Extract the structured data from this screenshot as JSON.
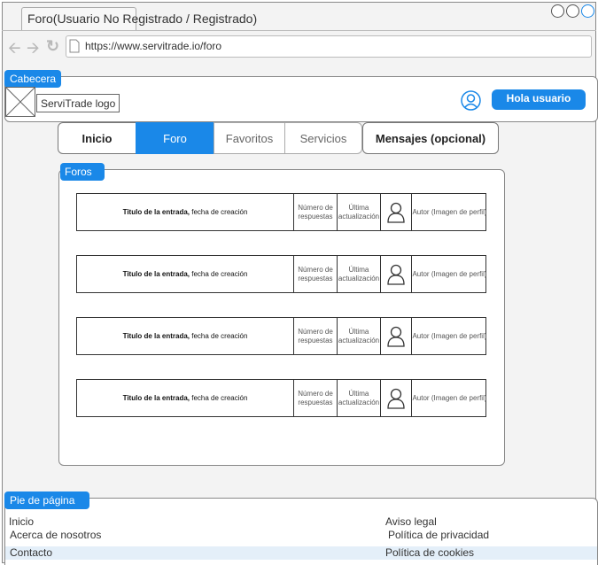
{
  "browser": {
    "tab_title": "Foro(Usuario No Registrado / Registrado)",
    "url": "https://www.servitrade.io/foro"
  },
  "header": {
    "section_label": "Cabecera",
    "logo_text": "ServiTrade logo",
    "user_button": "Hola usuario"
  },
  "nav": {
    "tabs": [
      "Inicio",
      "Foro",
      "Favoritos",
      "Servicios",
      "Mensajes (opcional)"
    ],
    "active": "Foro"
  },
  "forums": {
    "section_label": "Foros",
    "rows": [
      {
        "title": "Titulo de la entrada,",
        "date": " fecha de creación",
        "replies": "Número de respuestas",
        "updated": "Última actualización",
        "author": "Autor (Imagen de perfil)"
      },
      {
        "title": "Titulo de la entrada,",
        "date": " fecha de creación",
        "replies": "Número de respuestas",
        "updated": "Última actualización",
        "author": "Autor (Imagen de perfil)"
      },
      {
        "title": "Titulo de la entrada,",
        "date": " fecha de creación",
        "replies": "Número de respuestas",
        "updated": "Última actualización",
        "author": "Autor (Imagen de perfil)"
      },
      {
        "title": "Titulo de la entrada,",
        "date": " fecha de creación",
        "replies": "Número de respuestas",
        "updated": "Última actualización",
        "author": "Autor (Imagen de perfil)"
      }
    ]
  },
  "footer": {
    "section_label": "Pie de página",
    "left_links": [
      "Inicio",
      "Acerca de nosotros",
      "Contacto"
    ],
    "right_links": [
      "Aviso legal",
      "Política de privacidad",
      "Política de cookies"
    ]
  },
  "colors": {
    "accent": "#1a88e8",
    "border": "#888888"
  }
}
